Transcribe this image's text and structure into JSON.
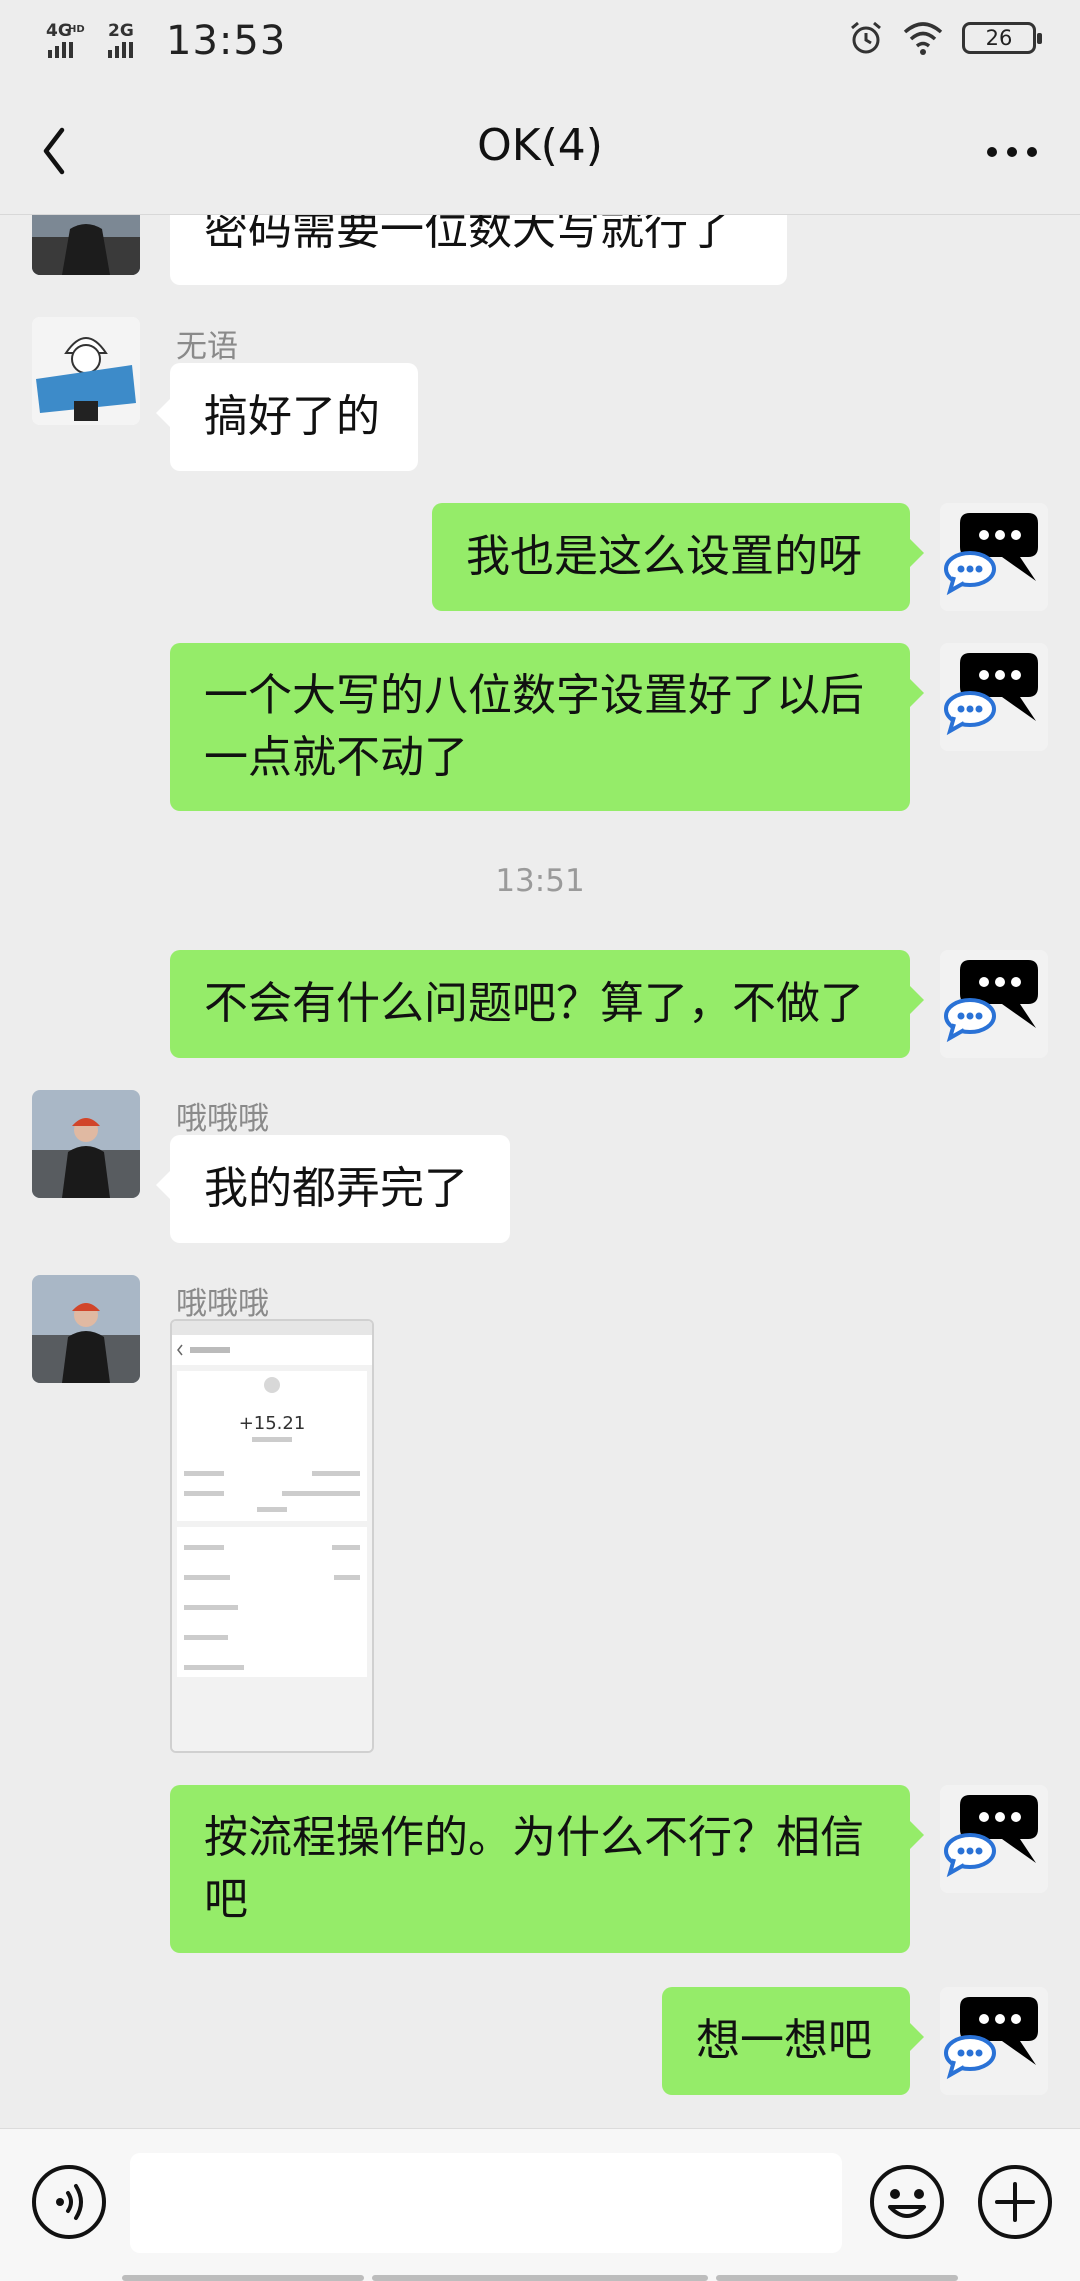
{
  "status_bar": {
    "network_1": "4G",
    "network_1_sup": "HD",
    "network_2": "2G",
    "time": "13:53",
    "battery": "26"
  },
  "header": {
    "title": "OK(4)"
  },
  "messages": [
    {
      "side": "left",
      "text": "密码需要一位数大写就行了"
    },
    {
      "side": "left",
      "sender": "无语",
      "text": "搞好了的"
    },
    {
      "side": "right",
      "text": "我也是这么设置的呀"
    },
    {
      "side": "right",
      "text": "一个大写的八位数字设置好了以后一点就不动了"
    },
    {
      "type": "time",
      "text": "13:51"
    },
    {
      "side": "right",
      "text": "不会有什么问题吧？算了，不做了"
    },
    {
      "side": "left",
      "sender": "哦哦哦",
      "text": "我的都弄完了"
    },
    {
      "side": "left",
      "sender": "哦哦哦",
      "type": "image"
    },
    {
      "side": "right",
      "text": "按流程操作的。为什么不行？相信吧"
    },
    {
      "side": "right",
      "text": "想一想吧"
    }
  ],
  "screenshot_preview": {
    "amount": "+15.21"
  },
  "colors": {
    "background": "#ededed",
    "bubble_self": "#95ec69",
    "bubble_other": "#ffffff",
    "text_muted": "#8a8a8a"
  },
  "icons": {
    "back": "chevron-left-icon",
    "more": "more-dots-icon",
    "voice": "voice-icon",
    "emoji": "emoji-icon",
    "plus": "plus-icon"
  }
}
